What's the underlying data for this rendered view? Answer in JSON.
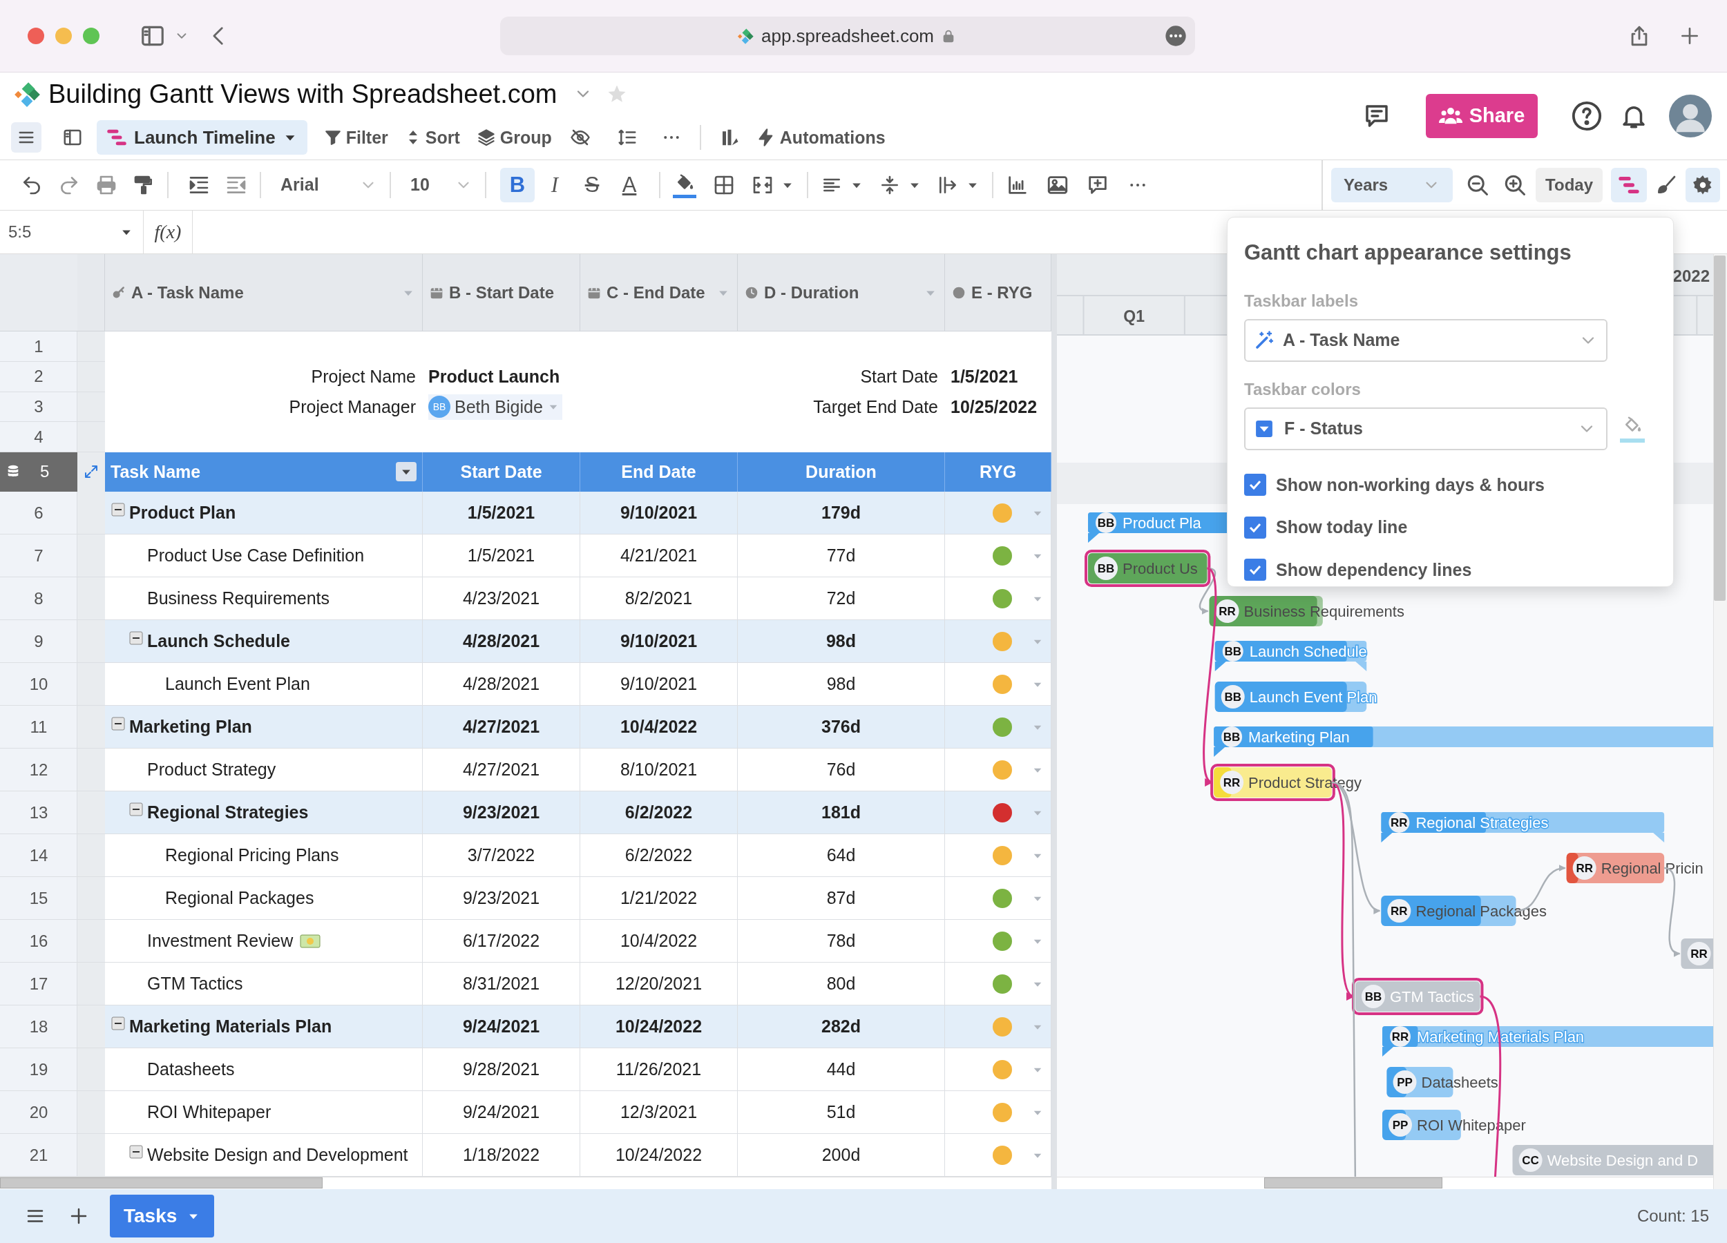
{
  "browser": {
    "url": "app.spreadsheet.com"
  },
  "document": {
    "title": "Building Gantt Views with Spreadsheet.com"
  },
  "view": {
    "label": "Launch Timeline"
  },
  "toolbar": [
    {
      "kind": "filter",
      "label": "Filter"
    },
    {
      "kind": "sort",
      "label": "Sort"
    },
    {
      "kind": "group",
      "label": "Group"
    },
    {
      "kind": "automations",
      "label": "Automations"
    }
  ],
  "share": {
    "label": "Share"
  },
  "format": {
    "font": "Arial",
    "size": "10",
    "buttons": [
      {
        "kind": "bold",
        "glyph": "B",
        "selected": true
      },
      {
        "kind": "italic",
        "glyph": "I",
        "selected": false
      },
      {
        "kind": "strike",
        "glyph": "S",
        "selected": false
      },
      {
        "kind": "text-color",
        "glyph": "A",
        "selected": false
      }
    ]
  },
  "timeline": {
    "scale": "Years",
    "today": "Today",
    "gantt_view": true,
    "settings_open": true
  },
  "formula_bar": {
    "cell": "5:5",
    "function_label": "f(x)"
  },
  "columns": [
    {
      "kind": "key",
      "label": "A - Task Name",
      "menu": true
    },
    {
      "kind": "date",
      "label": "B - Start Date",
      "menu": false
    },
    {
      "kind": "date",
      "label": "C - End Date",
      "menu": true
    },
    {
      "kind": "duration",
      "label": "D - Duration",
      "menu": true
    },
    {
      "kind": "status",
      "label": "E - RYG",
      "menu": false
    }
  ],
  "info_rows": [
    "1",
    "2",
    "3",
    "4"
  ],
  "project": {
    "name_label": "Project Name",
    "name": "Product Launch",
    "manager_label": "Project Manager",
    "manager_initials": "BB",
    "manager": "Beth Bigide",
    "start_label": "Start Date",
    "start": "1/5/2021",
    "target_label": "Target End Date",
    "target": "10/25/2022"
  },
  "header_row": {
    "number": "5",
    "cells": [
      "Task Name",
      "Start Date",
      "End Date",
      "Duration",
      "RYG"
    ]
  },
  "tasks": [
    {
      "number": "6",
      "name": "Product Plan",
      "start": "1/5/2021",
      "end": "9/10/2021",
      "duration": "179d",
      "color": "#f4b63f",
      "expanded": true,
      "bar": {
        "kind": "summary",
        "initials": "BB",
        "label": "Product Pla",
        "color": "#47a3ec",
        "level": 1
      },
      "children": [
        {
          "number": "7",
          "name": "Product Use Case Definition",
          "start": "1/5/2021",
          "end": "4/21/2021",
          "duration": "77d",
          "color": "#7cb342",
          "bar": {
            "kind": "task",
            "initials": "BB",
            "label": "Product Us",
            "color": "#5ea65a",
            "level": 1,
            "critical": true,
            "dark_label": true
          }
        },
        {
          "number": "8",
          "name": "Business Requirements",
          "start": "4/23/2021",
          "end": "8/2/2021",
          "duration": "72d",
          "color": "#7cb342",
          "bar": {
            "kind": "task",
            "initials": "RR",
            "label": "Business Requirements",
            "color": "#5ea65a",
            "level": 0.95,
            "critical": false,
            "dark_label": true
          }
        },
        {
          "number": "9",
          "name": "Launch Schedule",
          "start": "4/28/2021",
          "end": "9/10/2021",
          "duration": "98d",
          "color": "#f4b63f",
          "expanded": true,
          "bar": {
            "kind": "summary",
            "initials": "BB",
            "label": "Launch Schedule",
            "color": "#47a3ec",
            "level": 0.87
          },
          "children": [
            {
              "number": "10",
              "name": "Launch Event Plan",
              "start": "4/28/2021",
              "end": "9/10/2021",
              "duration": "98d",
              "color": "#f4b63f",
              "bar": {
                "kind": "task",
                "initials": "BB",
                "label": "Launch Event Plan",
                "color": "#47a3ec",
                "level": 0.87,
                "critical": false,
                "dark_label": false
              }
            }
          ]
        }
      ]
    },
    {
      "number": "11",
      "name": "Marketing Plan",
      "start": "4/27/2021",
      "end": "10/4/2022",
      "duration": "376d",
      "color": "#7cb342",
      "expanded": true,
      "bar": {
        "kind": "summary",
        "initials": "BB",
        "label": "Marketing Plan",
        "color": "#47a3ec",
        "level": 0.27
      },
      "children": [
        {
          "number": "12",
          "name": "Product Strategy",
          "start": "4/27/2021",
          "end": "8/10/2021",
          "duration": "76d",
          "color": "#f4b63f",
          "bar": {
            "kind": "task",
            "initials": "RR",
            "label": "Product Strategy",
            "color": "#f5dc3c",
            "level": 0.15,
            "critical": true,
            "dark_label": true
          }
        },
        {
          "number": "13",
          "name": "Regional Strategies",
          "start": "9/23/2021",
          "end": "6/2/2022",
          "duration": "181d",
          "color": "#d32f2f",
          "expanded": true,
          "bar": {
            "kind": "summary",
            "initials": "RR",
            "label": "Regional Strategies",
            "color": "#47a3ec",
            "level": 0.37
          },
          "children": [
            {
              "number": "14",
              "name": "Regional Pricing Plans",
              "start": "3/7/2022",
              "end": "6/2/2022",
              "duration": "64d",
              "color": "#f4b63f",
              "bar": {
                "kind": "task",
                "initials": "RR",
                "label": "Regional Pricin",
                "color": "#e2553f",
                "level": 0.12,
                "critical": false,
                "dark_label": true
              }
            },
            {
              "number": "15",
              "name": "Regional Packages",
              "start": "9/23/2021",
              "end": "1/21/2022",
              "duration": "87d",
              "color": "#7cb342",
              "bar": {
                "kind": "task",
                "initials": "RR",
                "label": "Regional Packages",
                "color": "#47a3ec",
                "level": 0.74,
                "critical": false,
                "dark_label": true
              }
            }
          ]
        },
        {
          "number": "16",
          "name": "Investment Review",
          "money_icon": true,
          "start": "6/17/2022",
          "end": "10/4/2022",
          "duration": "78d",
          "color": "#7cb342",
          "bar": {
            "kind": "task",
            "initials": "RR",
            "color": "#c1c7ce",
            "level": 1,
            "critical": false
          }
        },
        {
          "number": "17",
          "name": "GTM Tactics",
          "start": "8/31/2021",
          "end": "12/20/2021",
          "duration": "80d",
          "color": "#7cb342",
          "bar": {
            "kind": "task",
            "initials": "BB",
            "label": "GTM Tactics",
            "color": "#c1c7ce",
            "level": 1,
            "critical": true,
            "dark_label": false
          }
        }
      ]
    },
    {
      "number": "18",
      "name": "Marketing Materials Plan",
      "start": "9/24/2021",
      "end": "10/24/2022",
      "duration": "282d",
      "color": "#f4b63f",
      "expanded": true,
      "bar": {
        "kind": "summary",
        "initials": "RR",
        "label": "Marketing Materials Plan",
        "color": "#47a3ec",
        "level": 0.08
      },
      "children": [
        {
          "number": "19",
          "name": "Datasheets",
          "start": "9/28/2021",
          "end": "11/26/2021",
          "duration": "44d",
          "color": "#f4b63f",
          "bar": {
            "kind": "task",
            "initials": "PP",
            "label": "Datasheets",
            "color": "#47a3ec",
            "level": 0.3,
            "critical": false,
            "dark_label": true
          }
        },
        {
          "number": "20",
          "name": "ROI Whitepaper",
          "start": "9/24/2021",
          "end": "12/3/2021",
          "duration": "51d",
          "color": "#f4b63f",
          "bar": {
            "kind": "task",
            "initials": "PP",
            "label": "ROI Whitepaper",
            "color": "#47a3ec",
            "level": 0.3,
            "critical": false,
            "dark_label": true
          }
        },
        {
          "number": "21",
          "name": "Website Design and Development",
          "start": "1/18/2022",
          "end": "10/24/2022",
          "duration": "200d",
          "color": "#f4b63f",
          "expanded": true,
          "bar": {
            "kind": "task",
            "initials": "CC",
            "label": "Website Design and D",
            "color": "#c1c7ce",
            "level": 1,
            "critical": false,
            "dark_label": false
          }
        }
      ]
    }
  ],
  "gantt_header": {
    "year": "2022",
    "quarter": "Q1"
  },
  "settings": {
    "title": "Gantt chart appearance settings",
    "label_caption": "Taskbar labels",
    "label_field": "A - Task Name",
    "color_caption": "Taskbar colors",
    "color_field": "F - Status",
    "options": [
      {
        "label": "Show non-working days & hours",
        "checked": true
      },
      {
        "label": "Show today line",
        "checked": true
      },
      {
        "label": "Show dependency lines",
        "checked": true
      }
    ]
  },
  "sheets": [
    {
      "label": "Tasks",
      "selected": true
    }
  ],
  "footer": {
    "count": "Count: 15"
  }
}
